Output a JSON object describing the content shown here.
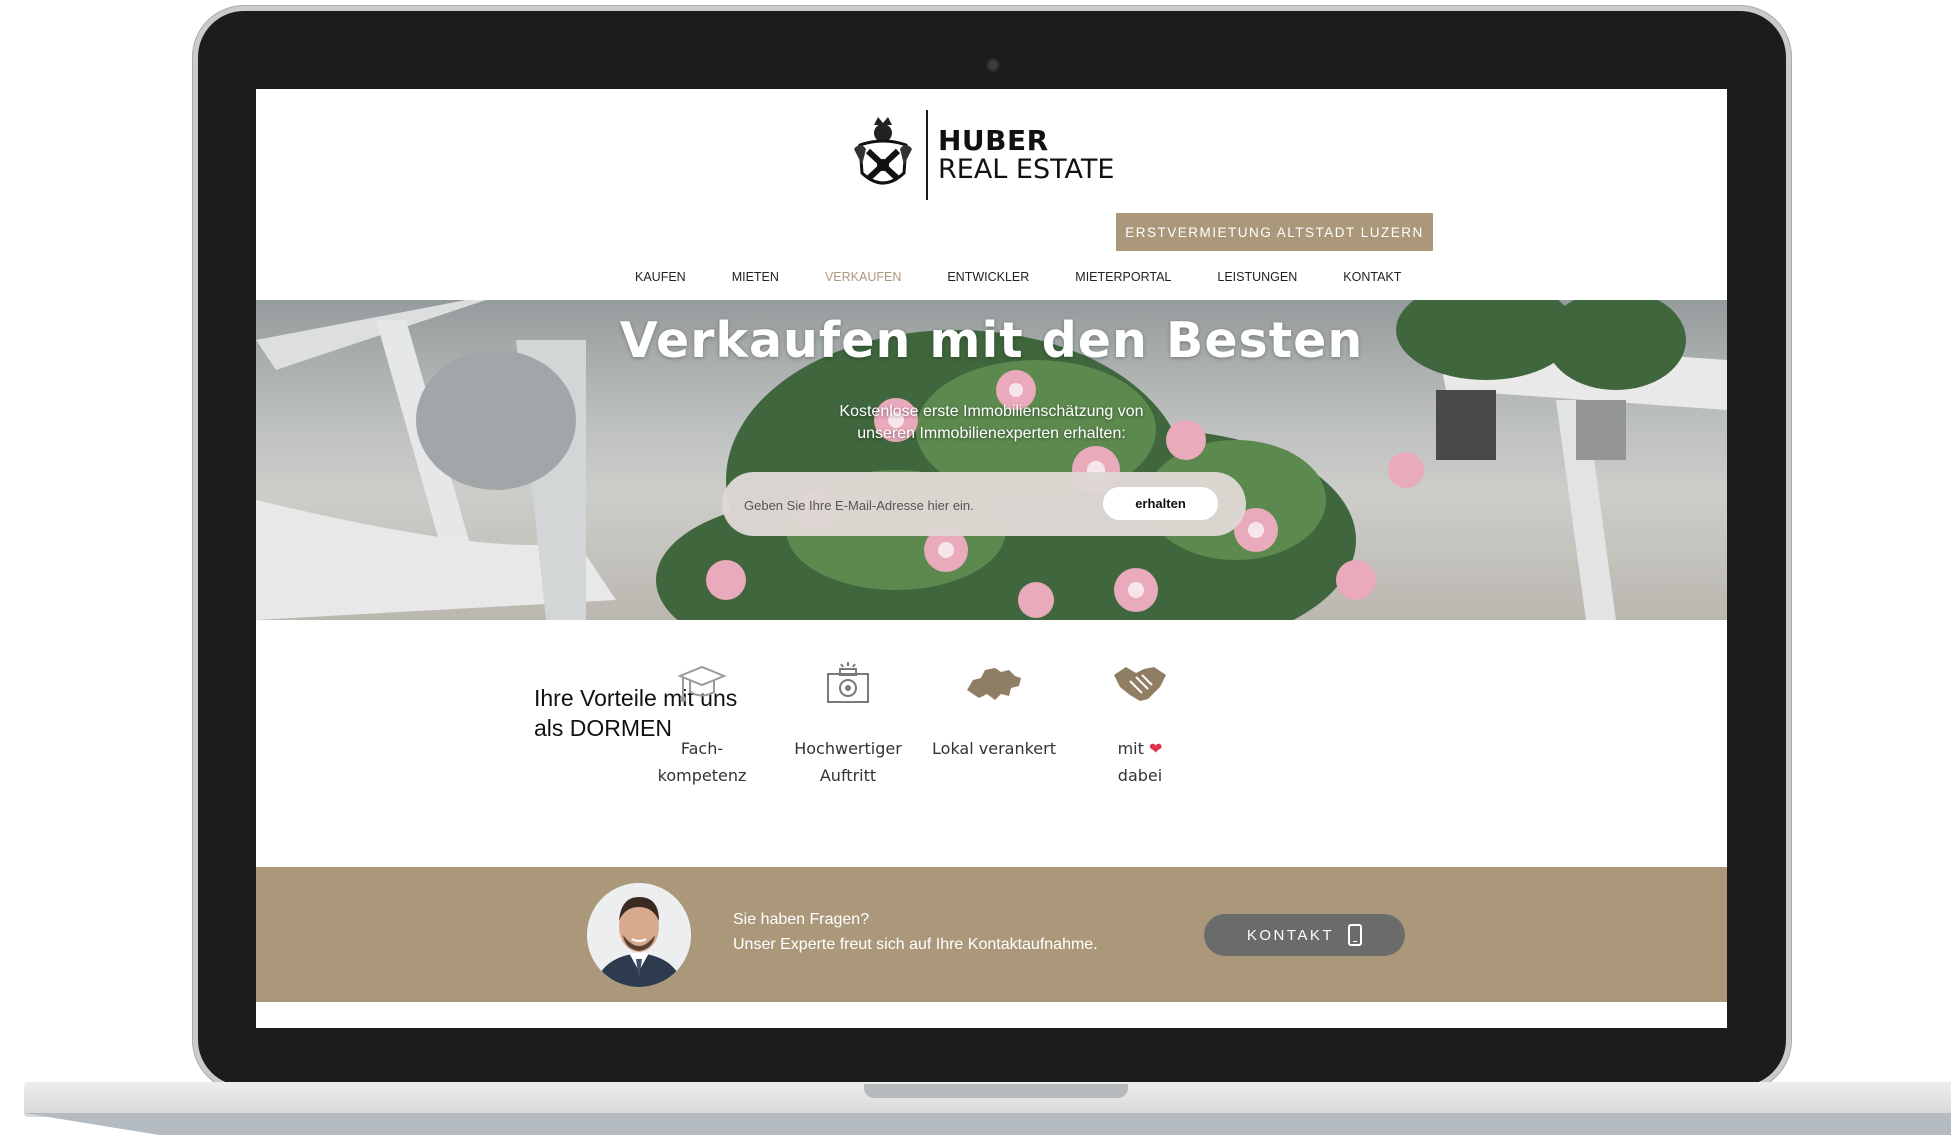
{
  "logo": {
    "line1": "HUBER",
    "line2": "REAL ESTATE"
  },
  "promo": {
    "label": "ERSTVERMIETUNG ALTSTADT LUZERN"
  },
  "nav": {
    "items": [
      {
        "label": "KAUFEN"
      },
      {
        "label": "MIETEN"
      },
      {
        "label": "VERKAUFEN",
        "active": true
      },
      {
        "label": "ENTWICKLER"
      },
      {
        "label": "MIETERPORTAL"
      },
      {
        "label": "LEISTUNGEN"
      },
      {
        "label": "KONTAKT"
      }
    ]
  },
  "hero": {
    "title": "Verkaufen mit den Besten",
    "subtitle_line1": "Kostenlose erste Immobilienschätzung von",
    "subtitle_line2": "unseren Immobilienexperten erhalten:",
    "email_placeholder": "Geben Sie Ihre E-Mail-Adresse hier ein.",
    "submit_label": "erhalten"
  },
  "benefits": {
    "title_line1": "Ihre Vorteile mit uns",
    "title_line2": "als DORMEN",
    "items": [
      {
        "line1": "Fach-",
        "line2": "kompetenz",
        "icon": "graduation-cap-icon"
      },
      {
        "line1": "Hochwertiger",
        "line2": "Auftritt",
        "icon": "camera-icon"
      },
      {
        "line1": "Lokal verankert",
        "line2": "",
        "icon": "switzerland-map-icon"
      },
      {
        "line1": "mit",
        "line2": "dabei",
        "icon": "handshake-icon",
        "heart": "❤"
      }
    ]
  },
  "contact": {
    "line1": "Sie haben Fragen?",
    "line2": "Unser Experte freut sich auf Ihre Kontaktaufnahme.",
    "button_label": "KONTAKT"
  },
  "colors": {
    "accent": "#ab987a",
    "button_dark": "#6b6b6b",
    "heart": "#e0324b"
  }
}
